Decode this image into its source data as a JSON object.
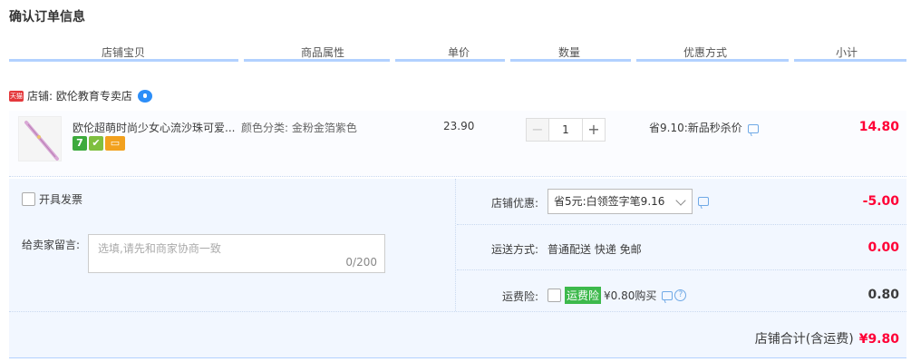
{
  "page_title": "确认订单信息",
  "columns": [
    "店铺宝贝",
    "商品属性",
    "单价",
    "数量",
    "优惠方式",
    "小计"
  ],
  "shop": {
    "badge": "天猫",
    "label": "店铺: 欧伦教育专卖店"
  },
  "item": {
    "title": "欧伦超萌时尚少女心流沙珠可爱...",
    "attribute": "颜色分类: 金粉金箔紫色",
    "unit_price": "23.90",
    "quantity": "1",
    "minus": "−",
    "plus": "+",
    "discount": "省9.10:新品秒杀价",
    "subtotal": "14.80",
    "service_icons": [
      "7",
      "b",
      "card"
    ]
  },
  "invoice_label": "开具发票",
  "memo": {
    "label": "给卖家留言:",
    "placeholder": "选填,请先和商家协商一致",
    "counter": "0/200"
  },
  "shop_discount": {
    "label": "店铺优惠:",
    "selected": "省5元:白领签字笔9.16",
    "amount": "-5.00"
  },
  "shipping": {
    "label": "运送方式:",
    "value": "普通配送 快递 免邮",
    "amount": "0.00"
  },
  "insurance": {
    "label": "运费险:",
    "tag": "运费险",
    "text": "¥0.80购买",
    "amount": "0.80"
  },
  "total": {
    "label": "店铺合计(含运费)",
    "value": "¥9.80"
  },
  "colors": {
    "accent_red": "#ff0036",
    "header_line": "#b2d1ff",
    "panel_bg": "#f2f7ff",
    "tmall_red": "#e4393c",
    "insurance_green": "#3db94c"
  }
}
